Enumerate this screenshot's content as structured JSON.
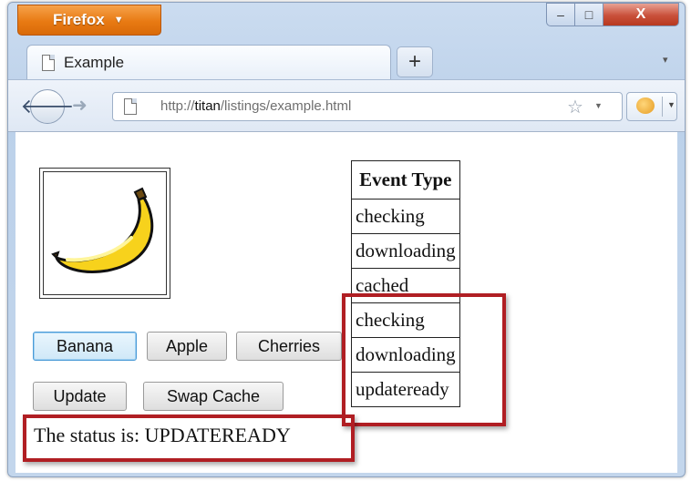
{
  "browser": {
    "app_menu_label": "Firefox",
    "tab_title": "Example",
    "new_tab_label": "+",
    "url_prefix": "http://",
    "url_host": "titan",
    "url_path": "/listings/example.html",
    "window_controls": {
      "minimize": "–",
      "maximize": "□",
      "close": "X"
    }
  },
  "page": {
    "image_alt": "banana",
    "fruit_buttons": [
      "Banana",
      "Apple",
      "Cherries"
    ],
    "update_label": "Update",
    "swap_cache_label": "Swap Cache",
    "status_text": "The status is: UPDATEREADY",
    "events_table": {
      "header": "Event Type",
      "rows": [
        "checking",
        "downloading",
        "cached",
        "checking",
        "downloading",
        "updateready"
      ]
    }
  },
  "colors": {
    "highlight": "#b01e23",
    "firefox_orange": "#e87a13"
  },
  "icons": {
    "back": "back-arrow-icon",
    "forward": "forward-arrow-icon",
    "page": "page-icon",
    "bookmark": "star-icon",
    "addon": "firebug-icon"
  }
}
